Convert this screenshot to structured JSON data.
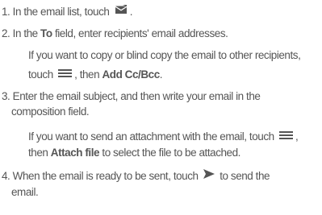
{
  "steps": [
    {
      "pre": "1. In the email list, touch",
      "icon": "compose-email-icon",
      "post": "."
    },
    {
      "pre": "2. In the ",
      "bold": "To",
      "post": " field, enter recipients' email addresses.",
      "note": {
        "line1": "If you want to copy or blind copy the email to other recipients,",
        "pre": "touch",
        "icon": "menu-icon",
        "mid": ", then ",
        "bold": "Add Cc/Bcc",
        "post": "."
      }
    },
    {
      "line1": "3. Enter the email subject, and then write your email in the",
      "line2": "composition field.",
      "note": {
        "pre": "If you want to send an attachment with the email, touch",
        "icon": "menu-icon",
        "post1": ",",
        "line2_pre": "then ",
        "bold": "Attach file",
        "line2_post": " to select the file to be attached."
      }
    },
    {
      "pre": "4. When the email is ready to be sent, touch",
      "icon": "send-icon",
      "post": "to send the",
      "line2": "email."
    }
  ],
  "colors": {
    "text": "#555555",
    "icon": "#555555"
  }
}
